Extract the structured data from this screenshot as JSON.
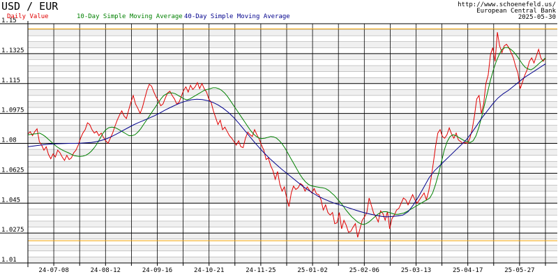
{
  "title": "USD / EUR",
  "header_right": {
    "url": "http://www.schoenefeld.us/",
    "source": "European Central Bank",
    "date": "2025-05-30"
  },
  "legend": [
    {
      "label": "Daily Value",
      "color": "#e00000"
    },
    {
      "label": "10-Day Simple Moving Average",
      "color": "#008000"
    },
    {
      "label": "40-Day Simple Moving Average",
      "color": "#00008c"
    }
  ],
  "colors": {
    "grid_major": "#000000",
    "grid_minor": "#999999",
    "band": "#f0f0f0",
    "limit_line": "#f0a000"
  },
  "chart_data": {
    "type": "line",
    "ylim": [
      1.01,
      1.15
    ],
    "y_ticks": [
      {
        "value": 1.15,
        "label": "1.15"
      },
      {
        "value": 1.1325,
        "label": "1.1325"
      },
      {
        "value": 1.115,
        "label": "1.115"
      },
      {
        "value": 1.0975,
        "label": "1.0975"
      },
      {
        "value": 1.08,
        "label": "1.08"
      },
      {
        "value": 1.0625,
        "label": "1.0625"
      },
      {
        "value": 1.045,
        "label": "1.045"
      },
      {
        "value": 1.0275,
        "label": "1.0275"
      },
      {
        "value": 1.01,
        "label": "1.01"
      }
    ],
    "x_ticks": [
      {
        "index": 0,
        "label": "24-07-08"
      },
      {
        "index": 2,
        "label": "24-08-12"
      },
      {
        "index": 4,
        "label": "24-09-16"
      },
      {
        "index": 6,
        "label": "24-10-21"
      },
      {
        "index": 8,
        "label": "24-11-25"
      },
      {
        "index": 10,
        "label": "25-01-02"
      },
      {
        "index": 12,
        "label": "25-02-06"
      },
      {
        "index": 14,
        "label": "25-03-13"
      },
      {
        "index": 16,
        "label": "25-04-17"
      },
      {
        "index": 18,
        "label": "25-05-27"
      }
    ],
    "limit_lines": [
      1.147,
      1.023
    ],
    "series": [
      {
        "name": "Daily Value",
        "color": "#e00000",
        "values": [
          1.0855,
          1.0868,
          1.0845,
          1.0868,
          1.0885,
          1.081,
          1.079,
          1.076,
          1.078,
          1.0735,
          1.071,
          1.0738,
          1.072,
          1.076,
          1.0745,
          1.072,
          1.07,
          1.073,
          1.0705,
          1.0715,
          1.0745,
          1.076,
          1.079,
          1.083,
          1.086,
          1.088,
          1.092,
          1.091,
          1.088,
          1.086,
          1.087,
          1.0845,
          1.086,
          1.0835,
          1.0815,
          1.08,
          1.083,
          1.086,
          1.09,
          1.0935,
          1.0965,
          1.099,
          1.096,
          1.0945,
          1.0995,
          1.104,
          1.108,
          1.103,
          1.1005,
          1.0975,
          1.101,
          1.106,
          1.111,
          1.1145,
          1.1135,
          1.11,
          1.107,
          1.105,
          1.102,
          1.103,
          1.1065,
          1.1095,
          1.1105,
          1.108,
          1.106,
          1.103,
          1.104,
          1.1075,
          1.111,
          1.113,
          1.11,
          1.114,
          1.1115,
          1.113,
          1.1155,
          1.112,
          1.115,
          1.112,
          1.11,
          1.106,
          1.104,
          1.099,
          1.095,
          1.091,
          1.0935,
          1.088,
          1.0895,
          1.087,
          1.0845,
          1.083,
          1.081,
          1.079,
          1.0815,
          1.078,
          1.0775,
          1.083,
          1.0865,
          1.085,
          1.084,
          1.088,
          1.085,
          1.0825,
          1.079,
          1.076,
          1.0705,
          1.0715,
          1.067,
          1.064,
          1.059,
          1.0635,
          1.056,
          1.052,
          1.0545,
          1.048,
          1.043,
          1.051,
          1.055,
          1.053,
          1.054,
          1.0565,
          1.0555,
          1.052,
          1.0545,
          1.0525,
          1.051,
          1.0535,
          1.0505,
          1.05,
          1.047,
          1.041,
          1.044,
          1.0395,
          1.038,
          1.0395,
          1.033,
          1.0335,
          1.0395,
          1.03,
          1.035,
          1.032,
          1.028,
          1.0285,
          1.031,
          1.033,
          1.025,
          1.03,
          1.035,
          1.037,
          1.0395,
          1.048,
          1.0435,
          1.039,
          1.037,
          1.034,
          1.0405,
          1.039,
          1.035,
          1.04,
          1.03,
          1.036,
          1.038,
          1.041,
          1.042,
          1.045,
          1.048,
          1.047,
          1.044,
          1.047,
          1.05,
          1.047,
          1.045,
          1.047,
          1.049,
          1.051,
          1.047,
          1.052,
          1.059,
          1.068,
          1.078,
          1.086,
          1.088,
          1.084,
          1.083,
          1.085,
          1.089,
          1.0855,
          1.083,
          1.086,
          1.082,
          1.081,
          1.08,
          1.0805,
          1.08,
          1.083,
          1.088,
          1.096,
          1.106,
          1.108,
          1.0975,
          1.103,
          1.115,
          1.12,
          1.132,
          1.136,
          1.128,
          1.145,
          1.137,
          1.133,
          1.137,
          1.138,
          1.136,
          1.133,
          1.13,
          1.125,
          1.121,
          1.112,
          1.116,
          1.12,
          1.123,
          1.128,
          1.13,
          1.127,
          1.131,
          1.135,
          1.13,
          1.128,
          1.13
        ]
      },
      {
        "name": "10-Day Simple Moving Average",
        "color": "#008000",
        "values": [
          1.085,
          1.0852,
          1.0855,
          1.0856,
          1.086,
          1.0852,
          1.084,
          1.0825,
          1.081,
          1.0795,
          1.078,
          1.077,
          1.076,
          1.0752,
          1.0745,
          1.0736,
          1.0728,
          1.0725,
          1.0723,
          1.0725,
          1.073,
          1.074,
          1.0755,
          1.0775,
          1.08,
          1.083,
          1.086,
          1.088,
          1.0892,
          1.0895,
          1.0893,
          1.0885,
          1.0875,
          1.0865,
          1.0855,
          1.0845,
          1.0845,
          1.085,
          1.0865,
          1.0885,
          1.091,
          1.0935,
          1.096,
          1.0985,
          1.101,
          1.1035,
          1.106,
          1.108,
          1.109,
          1.1095,
          1.1095,
          1.109,
          1.108,
          1.107,
          1.106,
          1.1055,
          1.106,
          1.107,
          1.108,
          1.109,
          1.11,
          1.111,
          1.1115,
          1.112,
          1.1125,
          1.1125,
          1.112,
          1.111,
          1.1095,
          1.1075,
          1.105,
          1.1025,
          1.1,
          1.0975,
          1.095,
          1.0925,
          1.09,
          1.0875,
          1.0855,
          1.084,
          1.083,
          1.0828,
          1.083,
          1.0835,
          1.084,
          1.0838,
          1.083,
          1.0815,
          1.0795,
          1.077,
          1.074,
          1.071,
          1.068,
          1.065,
          1.062,
          1.0595,
          1.0575,
          1.056,
          1.0552,
          1.0548,
          1.0545,
          1.0542,
          1.054,
          1.0535,
          1.0525,
          1.051,
          1.0495,
          1.0475,
          1.0455,
          1.0435,
          1.041,
          1.039,
          1.037,
          1.0355,
          1.034,
          1.033,
          1.0325,
          1.033,
          1.034,
          1.0355,
          1.037,
          1.0385,
          1.0395,
          1.04,
          1.04,
          1.0395,
          1.039,
          1.0385,
          1.0385,
          1.0388,
          1.0392,
          1.04,
          1.041,
          1.042,
          1.043,
          1.044,
          1.045,
          1.046,
          1.047,
          1.048,
          1.051,
          1.056,
          1.062,
          1.069,
          1.076,
          1.081,
          1.084,
          1.085,
          1.0845,
          1.0835,
          1.0825,
          1.0815,
          1.0808,
          1.0805,
          1.0815,
          1.0845,
          1.0895,
          1.096,
          1.103,
          1.11,
          1.117,
          1.123,
          1.128,
          1.132,
          1.135,
          1.136,
          1.136,
          1.135,
          1.1335,
          1.1315,
          1.129,
          1.1265,
          1.1245,
          1.1235,
          1.123,
          1.124,
          1.1255,
          1.127,
          1.1285,
          1.13
        ]
      },
      {
        "name": "40-Day Simple Moving Average",
        "color": "#00008c",
        "values": [
          1.078,
          1.0784,
          1.0788,
          1.0792,
          1.0795,
          1.0797,
          1.0798,
          1.0799,
          1.08,
          1.08,
          1.0801,
          1.0803,
          1.0805,
          1.081,
          1.0818,
          1.0828,
          1.0842,
          1.0858,
          1.0875,
          1.0892,
          1.0908,
          1.0922,
          1.0935,
          1.0948,
          1.0962,
          1.0978,
          1.0995,
          1.101,
          1.1025,
          1.1038,
          1.1048,
          1.1055,
          1.1058,
          1.1056,
          1.105,
          1.104,
          1.1025,
          1.1005,
          1.098,
          1.095,
          1.0915,
          1.0878,
          1.084,
          1.0803,
          1.0768,
          1.0735,
          1.0705,
          1.0677,
          1.065,
          1.0625,
          1.06,
          1.0575,
          1.055,
          1.0528,
          1.0508,
          1.049,
          1.0475,
          1.0462,
          1.045,
          1.044,
          1.043,
          1.042,
          1.041,
          1.04,
          1.0392,
          1.0385,
          1.0378,
          1.0372,
          1.037,
          1.0372,
          1.0375,
          1.038,
          1.04,
          1.044,
          1.049,
          1.0545,
          1.06,
          1.064,
          1.067,
          1.07,
          1.073,
          1.076,
          1.079,
          1.082,
          1.086,
          1.0905,
          1.095,
          1.099,
          1.103,
          1.1065,
          1.109,
          1.111,
          1.1135,
          1.116,
          1.1185,
          1.1205,
          1.1225,
          1.1245,
          1.1265
        ]
      }
    ]
  }
}
